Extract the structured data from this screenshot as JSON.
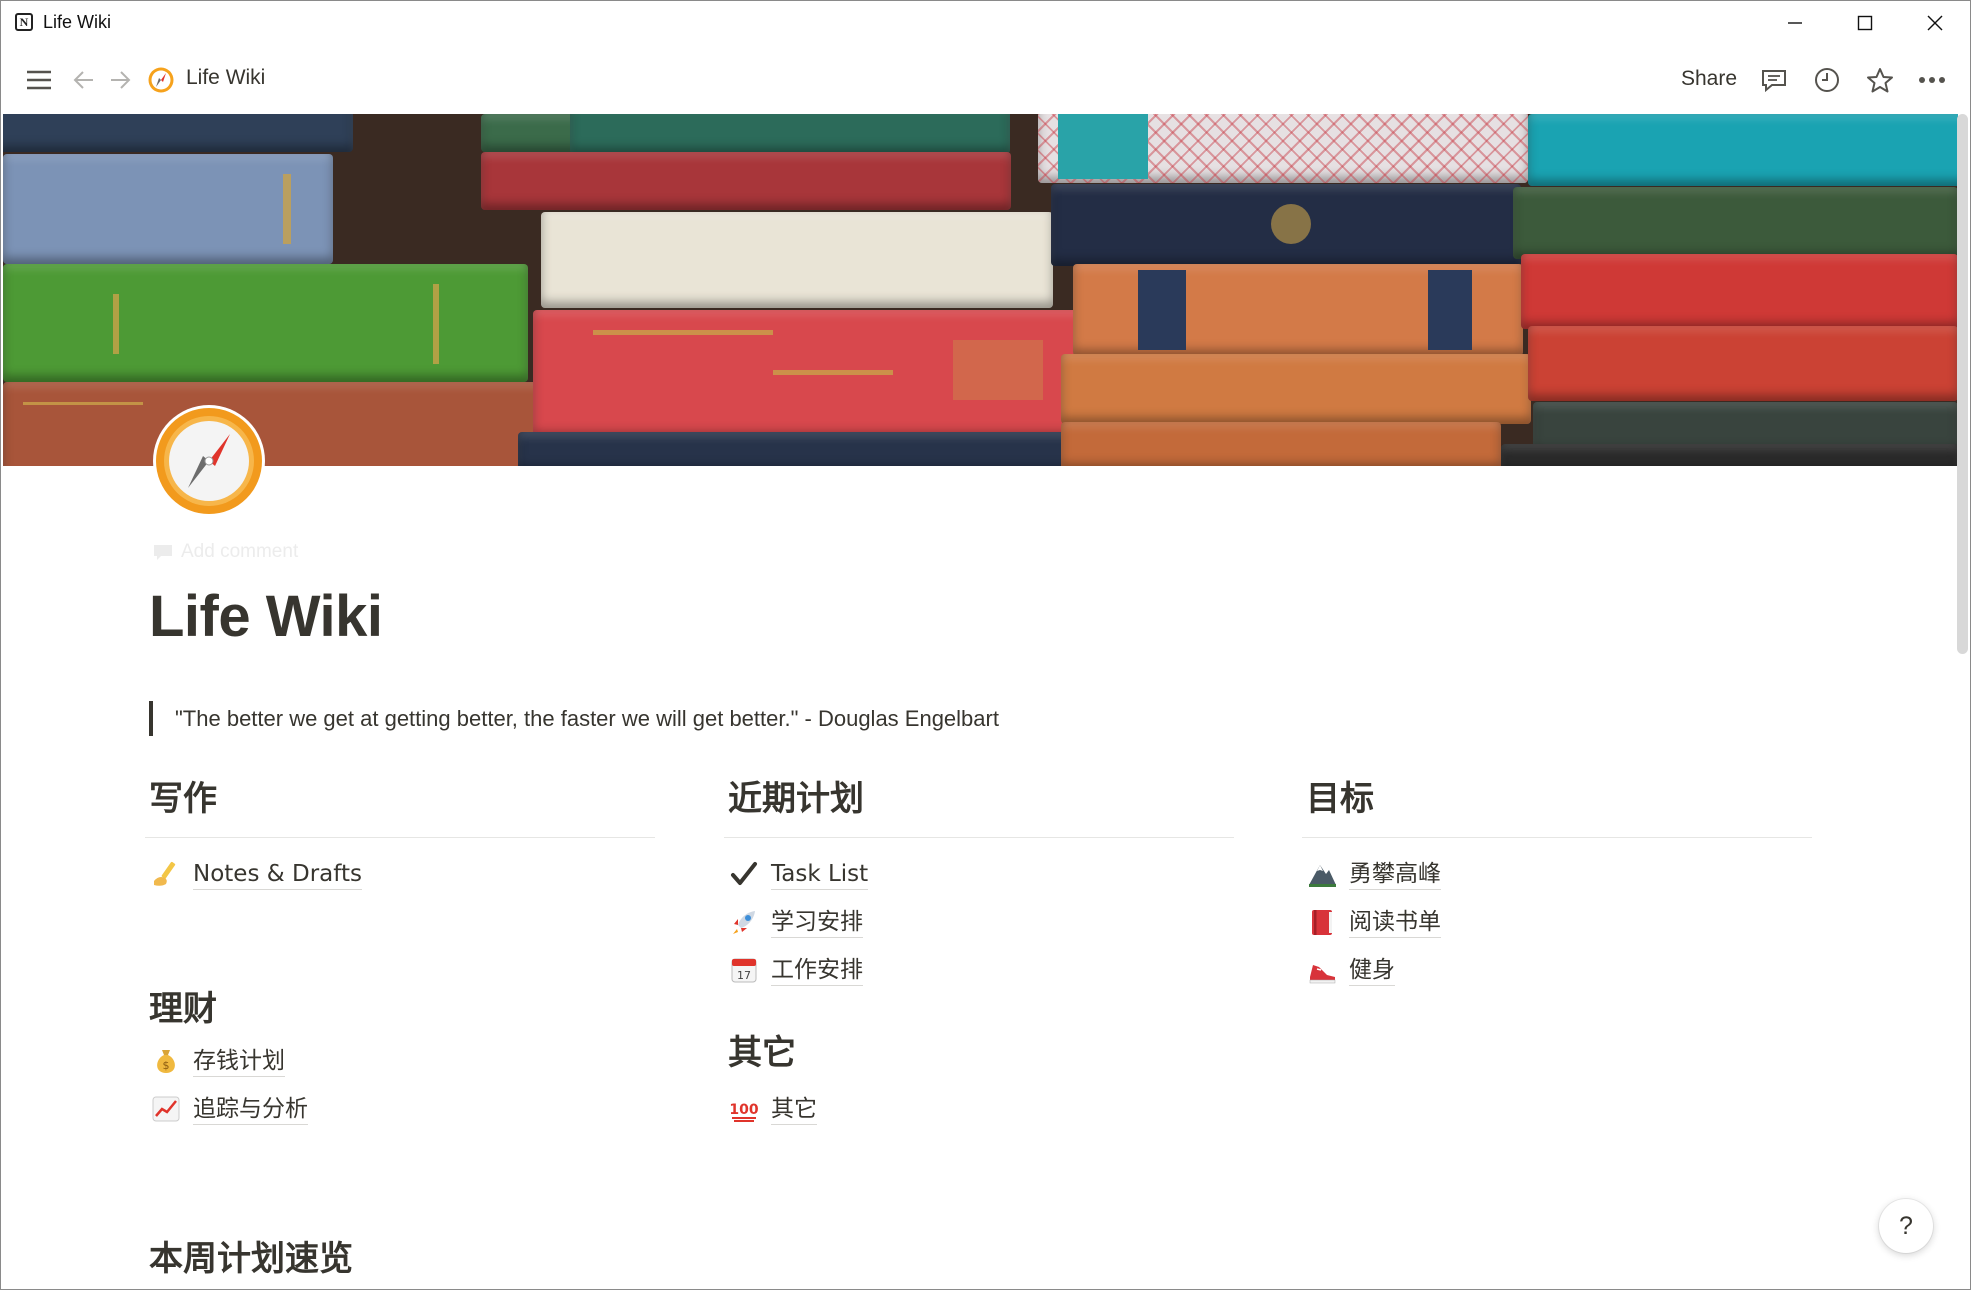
{
  "window": {
    "title": "Life Wiki"
  },
  "topbar": {
    "breadcrumb": "Life Wiki",
    "share_label": "Share"
  },
  "page": {
    "add_comment": "Add comment",
    "title": "Life Wiki",
    "quote": "\"The better we get at getting better, the faster we will get better.\" - Douglas Engelbart"
  },
  "sections": {
    "writing": {
      "heading": "写作",
      "links": [
        {
          "icon": "writing-hand-icon",
          "label": "Notes & Drafts"
        }
      ]
    },
    "finance": {
      "heading": "理财",
      "links": [
        {
          "icon": "money-bag-icon",
          "label": "存钱计划"
        },
        {
          "icon": "chart-increasing-icon",
          "label": "追踪与分析"
        }
      ]
    },
    "plans": {
      "heading": "近期计划",
      "links": [
        {
          "icon": "check-mark-icon",
          "label": "Task List"
        },
        {
          "icon": "rocket-icon",
          "label": "学习安排"
        },
        {
          "icon": "calendar-icon",
          "label": "工作安排"
        }
      ]
    },
    "other": {
      "heading": "其它",
      "links": [
        {
          "icon": "hundred-points-icon",
          "label": "其它"
        }
      ]
    },
    "goals": {
      "heading": "目标",
      "links": [
        {
          "icon": "mountain-icon",
          "label": "勇攀高峰"
        },
        {
          "icon": "red-book-icon",
          "label": "阅读书单"
        },
        {
          "icon": "running-shoe-icon",
          "label": "健身"
        }
      ]
    },
    "weekly": {
      "heading": "本周计划速览"
    }
  },
  "help_label": "?",
  "colors": {
    "text": "#37352f",
    "accent_orange": "#f29a1d",
    "divider": "#e6e6e4"
  }
}
